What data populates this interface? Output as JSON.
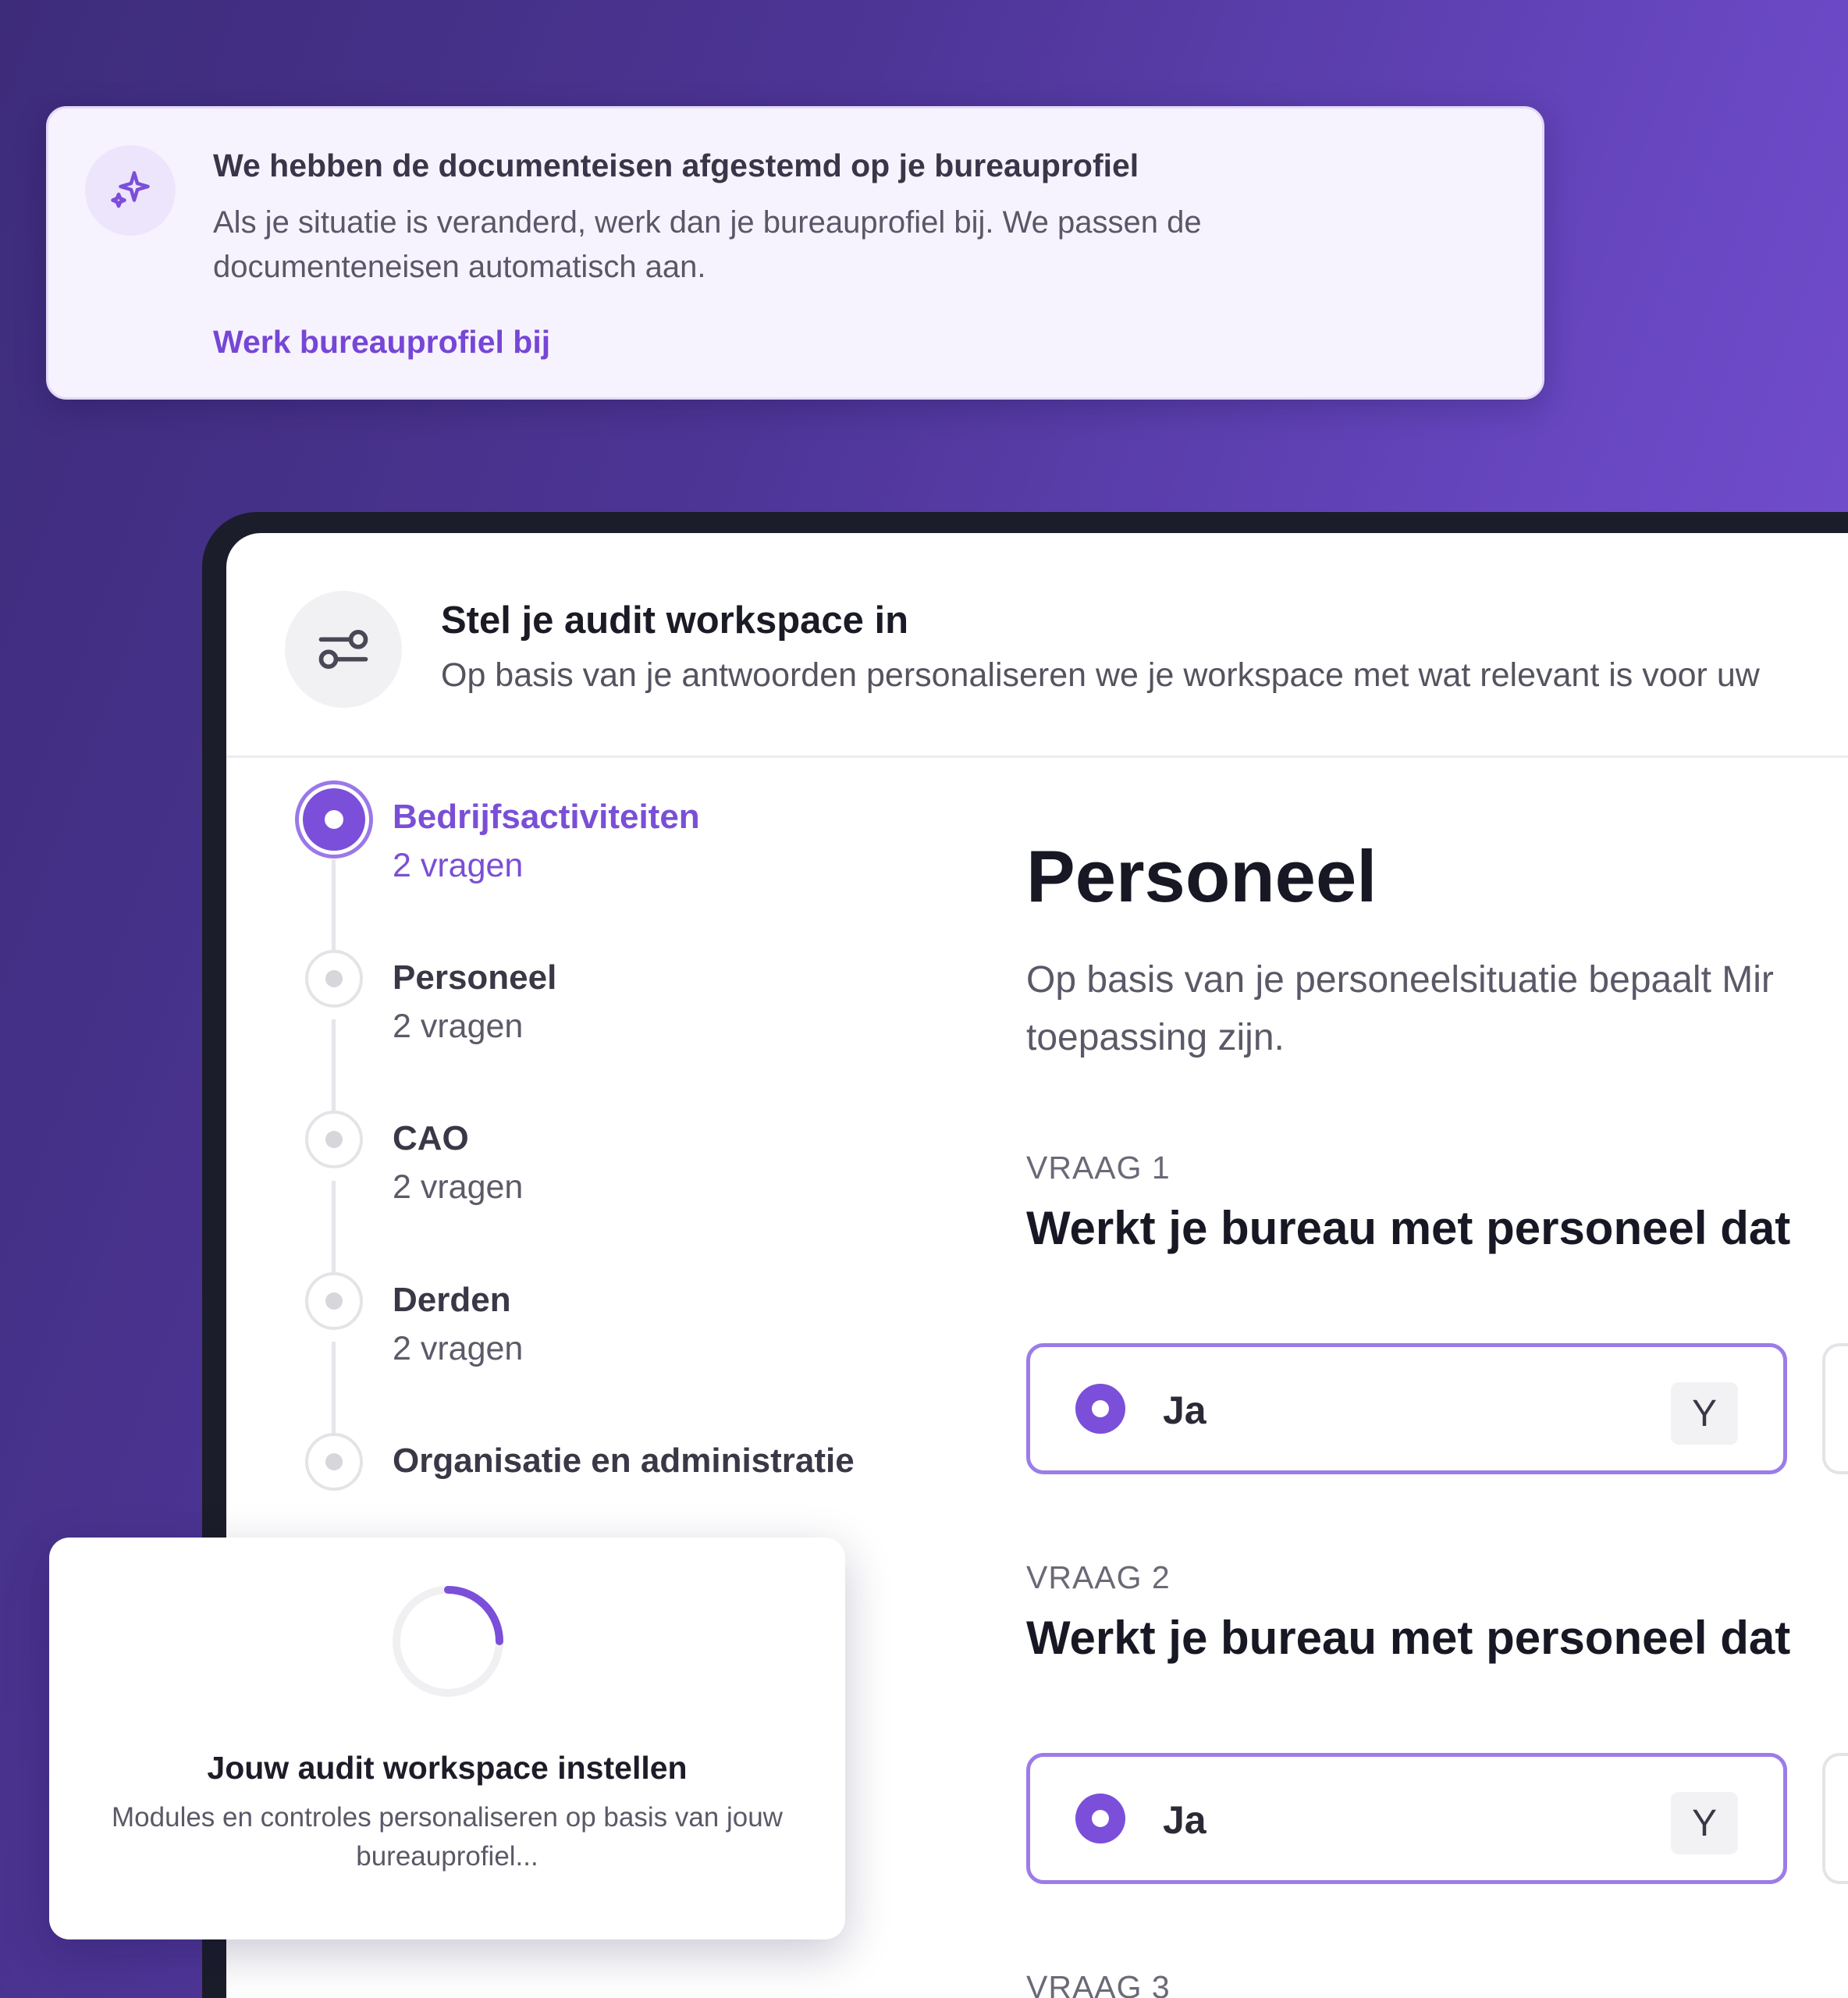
{
  "notice": {
    "icon": "sparkles-icon",
    "title": "We hebben de documenteisen afgestemd op je bureauprofiel",
    "body": "Als je situatie is veranderd, werk dan je bureauprofiel bij. We passen de documenteneisen automatisch aan.",
    "link": "Werk bureauprofiel bij"
  },
  "header": {
    "icon": "sliders-icon",
    "title": "Stel je audit workspace in",
    "subtitle": "Op basis van je antwoorden personaliseren we je workspace met wat relevant is voor uw"
  },
  "steps": [
    {
      "title": "Bedrijfsactiviteiten",
      "count": "2 vragen",
      "active": true
    },
    {
      "title": "Personeel",
      "count": "2 vragen",
      "active": false
    },
    {
      "title": "CAO",
      "count": "2 vragen",
      "active": false
    },
    {
      "title": "Derden",
      "count": "2 vragen",
      "active": false
    },
    {
      "title": "Organisatie en administratie",
      "count": "",
      "active": false
    }
  ],
  "content": {
    "title": "Personeel",
    "description": "Op basis van je personeelsituatie bepaalt Mir toepassing zijn.",
    "questions": [
      {
        "label": "VRAAG 1",
        "text": "Werkt je bureau met personeel dat",
        "option_label": "Ja",
        "option_key": "Y"
      },
      {
        "label": "VRAAG 2",
        "text": "Werkt je bureau met personeel dat",
        "option_label": "Ja",
        "option_key": "Y"
      },
      {
        "label": "VRAAG 3"
      }
    ]
  },
  "loading": {
    "title": "Jouw audit workspace instellen",
    "subtitle": "Modules en controles personaliseren op basis van jouw bureauprofiel..."
  },
  "colors": {
    "accent": "#7b4fd9",
    "accent_border": "#9c7ce8",
    "background_start": "#3d2c7a",
    "background_end": "#7d55d8"
  }
}
